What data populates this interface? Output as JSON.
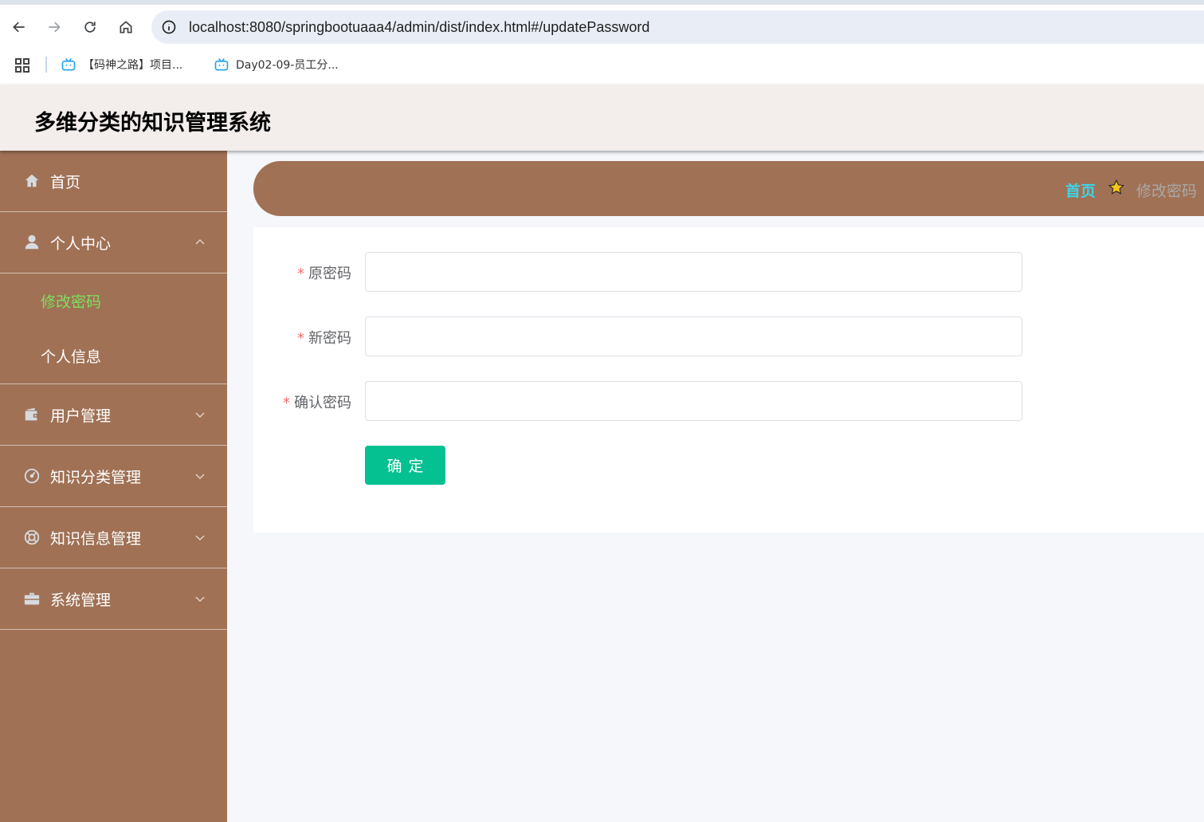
{
  "browser": {
    "url": "localhost:8080/springbootuaaa4/admin/dist/index.html#/updatePassword",
    "bookmarks": [
      {
        "label": "【码神之路】项目..."
      },
      {
        "label": "Day02-09-员工分..."
      }
    ]
  },
  "header": {
    "title": "多维分类的知识管理系统"
  },
  "sidebar": {
    "items": [
      {
        "label": "首页",
        "icon": "home-icon"
      },
      {
        "label": "个人中心",
        "icon": "user-icon",
        "expanded": true,
        "children": [
          {
            "label": "修改密码",
            "active": true
          },
          {
            "label": "个人信息",
            "active": false
          }
        ]
      },
      {
        "label": "用户管理",
        "icon": "wallet-icon"
      },
      {
        "label": "知识分类管理",
        "icon": "dashboard-icon"
      },
      {
        "label": "知识信息管理",
        "icon": "lifebuoy-icon"
      },
      {
        "label": "系统管理",
        "icon": "briefcase-icon"
      }
    ]
  },
  "breadcrumb": {
    "home": "首页",
    "current": "修改密码"
  },
  "form": {
    "old_password": {
      "label": "原密码",
      "value": ""
    },
    "new_password": {
      "label": "新密码",
      "value": ""
    },
    "confirm_password": {
      "label": "确认密码",
      "value": ""
    },
    "submit_label": "确定"
  },
  "colors": {
    "sidebar_bg": "#a07155",
    "header_bg": "#f3edec",
    "active_submenu": "#7ee05f",
    "breadcrumb_home": "#3fd3e8",
    "confirm_button": "#05c091",
    "required_star": "#f56c6c"
  }
}
